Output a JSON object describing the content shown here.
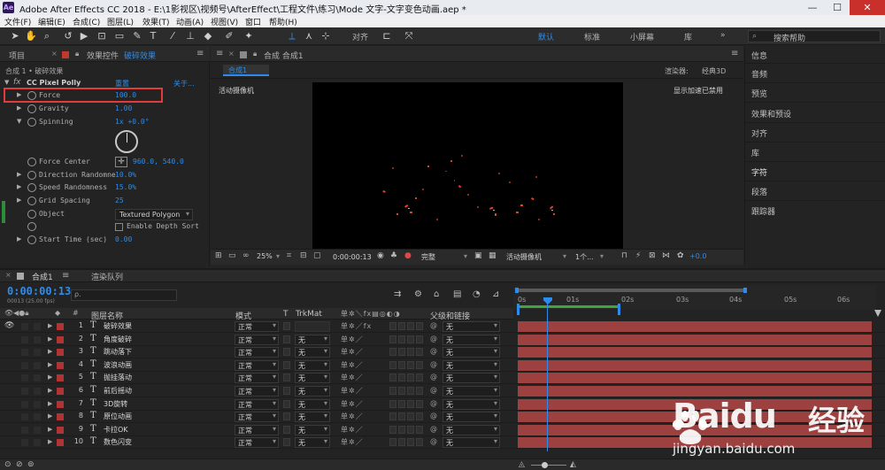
{
  "window": {
    "title": "Adobe After Effects CC 2018 - E:\\1影视区\\视频号\\AfterEffect\\工程文件\\练习\\Mode 文字-文字变色动画.aep *",
    "logo": "Ae",
    "controls": [
      "minimize-icon",
      "maximize-icon",
      "close-icon"
    ]
  },
  "menu": [
    "文件(F)",
    "编辑(E)",
    "合成(C)",
    "图层(L)",
    "效果(T)",
    "动画(A)",
    "视图(V)",
    "窗口",
    "帮助(H)"
  ],
  "toolbar": {
    "align_label": "对齐",
    "workspaces": [
      "默认",
      "标准",
      "小屏幕",
      "库"
    ],
    "active_workspace": "默认",
    "more": "»",
    "search_placeholder": "搜索帮助"
  },
  "effect_controls": {
    "tabs": [
      "项目",
      "效果控件",
      "破碎效果"
    ],
    "subtitle": "合成 1 • 破碎效果",
    "effect_name": "CC Pixel Polly",
    "reset": "重置",
    "about": "关于...",
    "params": [
      {
        "name": "Force",
        "value": "100.0",
        "highlight": true
      },
      {
        "name": "Gravity",
        "value": "1.00"
      },
      {
        "name": "Spinning",
        "value": "1x +0.0°"
      },
      {
        "name": "Force Center",
        "value": "960.0, 540.0"
      },
      {
        "name": "Direction Randomne",
        "value": "10.0%"
      },
      {
        "name": "Speed Randomness",
        "value": "15.0%"
      },
      {
        "name": "Grid Spacing",
        "value": "25"
      },
      {
        "name": "Object",
        "value": "Textured Polygon"
      },
      {
        "name": "",
        "value": "Enable Depth Sort"
      },
      {
        "name": "Start Time (sec)",
        "value": "0.00"
      }
    ]
  },
  "composition": {
    "panel_tab": "合成 合成1",
    "comp_tab": "合成1",
    "renderer_label": "渲染器:",
    "renderer_value": "经典3D",
    "camera_label": "活动摄像机",
    "gpu_label": "显示加速已禁用",
    "bottom_bar": {
      "zoom": "25%",
      "timecode": "0:00:00:13",
      "resolution": "完整",
      "camera": "活动摄像机",
      "views": "1个...",
      "exposure": "+0.0"
    }
  },
  "right_panel": {
    "items": [
      "信息",
      "音频",
      "预览",
      "效果和预设",
      "对齐",
      "库",
      "字符",
      "段落",
      "跟踪器"
    ]
  },
  "timeline": {
    "tabs": [
      "合成1",
      "渲染队列"
    ],
    "timecode": "0:00:00:13",
    "fps": "00013 (25.00 fps)",
    "search_placeholder": "ρ.",
    "columns": {
      "layer_name": "图层名称",
      "mode": "模式",
      "t": "T",
      "trkmat": "TrkMat",
      "parent": "父级和链接"
    },
    "ruler": [
      "0s",
      "01s",
      "02s",
      "03s",
      "04s",
      "05s",
      "06s"
    ],
    "layers": [
      {
        "num": "1",
        "name": "破碎效果",
        "mode": "正常",
        "trkmat": "",
        "parent": "无"
      },
      {
        "num": "2",
        "name": "角度破碎",
        "mode": "正常",
        "trkmat": "无",
        "parent": "无"
      },
      {
        "num": "3",
        "name": "跳动落下",
        "mode": "正常",
        "trkmat": "无",
        "parent": "无"
      },
      {
        "num": "4",
        "name": "波浪动画",
        "mode": "正常",
        "trkmat": "无",
        "parent": "无"
      },
      {
        "num": "5",
        "name": "抛挂落动",
        "mode": "正常",
        "trkmat": "无",
        "parent": "无"
      },
      {
        "num": "6",
        "name": "前后摇动",
        "mode": "正常",
        "trkmat": "无",
        "parent": "无"
      },
      {
        "num": "7",
        "name": "3D旋转",
        "mode": "正常",
        "trkmat": "无",
        "parent": "无"
      },
      {
        "num": "8",
        "name": "原位动画",
        "mode": "正常",
        "trkmat": "无",
        "parent": "无"
      },
      {
        "num": "9",
        "name": "卡拉OK",
        "mode": "正常",
        "trkmat": "无",
        "parent": "无"
      },
      {
        "num": "10",
        "name": "数色闪变",
        "mode": "正常",
        "trkmat": "无",
        "parent": "无"
      }
    ]
  },
  "watermark": {
    "brand": "Baidu",
    "sub": "经验",
    "url": "jingyan.baidu.com"
  }
}
